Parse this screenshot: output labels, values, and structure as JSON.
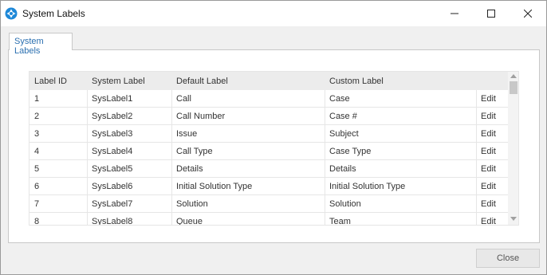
{
  "window": {
    "title": "System Labels"
  },
  "tabs": [
    {
      "label": "System Labels"
    }
  ],
  "grid": {
    "columns": [
      "Label ID",
      "System Label",
      "Default Label",
      "Custom Label",
      ""
    ],
    "rows": [
      {
        "id": "1",
        "system": "SysLabel1",
        "default": "Call",
        "custom": "Case",
        "action": "Edit"
      },
      {
        "id": "2",
        "system": "SysLabel2",
        "default": "Call Number",
        "custom": "Case #",
        "action": "Edit"
      },
      {
        "id": "3",
        "system": "SysLabel3",
        "default": "Issue",
        "custom": "Subject",
        "action": "Edit"
      },
      {
        "id": "4",
        "system": "SysLabel4",
        "default": "Call Type",
        "custom": "Case Type",
        "action": "Edit"
      },
      {
        "id": "5",
        "system": "SysLabel5",
        "default": "Details",
        "custom": "Details",
        "action": "Edit"
      },
      {
        "id": "6",
        "system": "SysLabel6",
        "default": "Initial Solution Type",
        "custom": "Initial Solution Type",
        "action": "Edit"
      },
      {
        "id": "7",
        "system": "SysLabel7",
        "default": "Solution",
        "custom": "Solution",
        "action": "Edit"
      },
      {
        "id": "8",
        "system": "SysLabel8",
        "default": "Queue",
        "custom": "Team",
        "action": "Edit"
      }
    ]
  },
  "footer": {
    "close_label": "Close"
  },
  "icons": {
    "app": "app-logo-icon",
    "minimize": "minimize-icon",
    "maximize": "maximize-icon",
    "close": "close-icon"
  },
  "colors": {
    "accent": "#2a6fb0",
    "app_icon": "#1e88d8"
  }
}
